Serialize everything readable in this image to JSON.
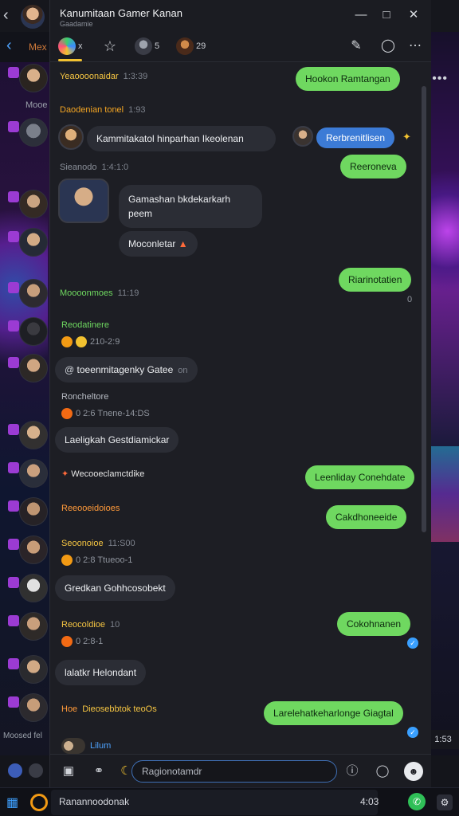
{
  "window": {
    "title": "Kanumitaan Gamer Kanan",
    "subtitle": "Gaadamie",
    "minimize_icon": "minimize-icon",
    "maximize_icon": "maximize-icon",
    "close_icon": "close-icon"
  },
  "outer": {
    "sub_label": "Mex",
    "more_label": "Mooe",
    "left_footer": "Moosed fel",
    "right_footer": "1:53"
  },
  "tabs": [
    {
      "label": "x",
      "icon": "joystick-icon",
      "active": true
    },
    {
      "label": "",
      "icon": "star-icon"
    },
    {
      "label": "5",
      "icon": "avatar-icon"
    },
    {
      "label": "29",
      "icon": "avatar-icon"
    }
  ],
  "tab_actions": {
    "pin": "pin-icon",
    "bookmark": "bookmark-icon",
    "more": "more-icon"
  },
  "messages": {
    "m1": {
      "sender": "Yeaoooonaidar",
      "meta": "1:3:39",
      "sender_color": "#f5c542"
    },
    "m1_out": "Hookon Ramtangan",
    "m2": {
      "sender": "Daodenian tonel",
      "meta": "1:93",
      "sender_color": "#f5a623"
    },
    "m2_text": "Kammitakatol hinparhan Ikeolenan",
    "m2_chip": "Rerbrenitlisen",
    "m3_out": "Reeroneva",
    "m4": {
      "sender": "Sieanodo",
      "meta": "1:4:1:0",
      "sender_color": "#8a8f99"
    },
    "m4_text_line1": "Gamashan bkdekarkarh",
    "m4_text_line2": "peem",
    "m5_text": "Moconletar",
    "m6_out": "Riarinotatien",
    "m6_meta": "0",
    "m7": {
      "sender": "Moooonmoes",
      "meta": "11:19",
      "sender_color": "#6fd860"
    },
    "m8": {
      "sender": "Reodatinere",
      "sender_color": "#6fd860"
    },
    "m8_react": "210-2:9",
    "m9_text": "toeenmitagenky Gatee",
    "m9_meta": "on",
    "m10": {
      "sender": "Roncheltore",
      "sender_color": "#b7bbc3"
    },
    "m10_react": "0 2:6  Tnene-14:DS",
    "m11_text": "Laeligkah  Gestdiamickar",
    "m12": {
      "sender": "Wecooeclamctdike",
      "sender_color": "#e6e6e6"
    },
    "m12_out": "Leenliday Conehdate",
    "m13": {
      "sender": "Reeooeidoioes",
      "sender_color": "#ff9a3a"
    },
    "m13_out": "Cakdhoneeide",
    "m14": {
      "sender": "Seoonoioe",
      "meta": "11:S00",
      "sender_color": "#f5c542"
    },
    "m14_react": "0 2:8  Ttueoo-1",
    "m15_text": "Gredkan  Gohhcosobekt",
    "m16": {
      "sender": "Reocoldioe",
      "meta": "10",
      "sender_color": "#f5c542"
    },
    "m16_react": "0 2:8-1",
    "m16_out": "Cokohnanen",
    "m17_text": "lalatkr  Helondant",
    "m18": {
      "sender": "Hoe",
      "meta": "Dieosebbtok teoOs",
      "sender_color": "#ff9a3a"
    },
    "m18_out": "Larelehatkeharlonge Giagtal"
  },
  "typing": {
    "name": "Lilum"
  },
  "input": {
    "placeholder": "Ragionotamdr",
    "attach_icon": "image-icon",
    "link_icon": "link-icon",
    "info_icon": "info-icon",
    "gif_icon": "gif-icon",
    "send_icon": "emoji-icon"
  },
  "taskbar": {
    "search_text": "Ranannoodonak",
    "time": "4:03",
    "start_icon": "windows-icon",
    "browser_icon": "browser-icon",
    "whatsapp_icon": "whatsapp-icon",
    "settings_icon": "settings-icon"
  },
  "colors": {
    "outgoing_bubble": "#6fd860",
    "incoming_bubble": "#2b2d35",
    "accent_blue": "#3c7bd6"
  }
}
